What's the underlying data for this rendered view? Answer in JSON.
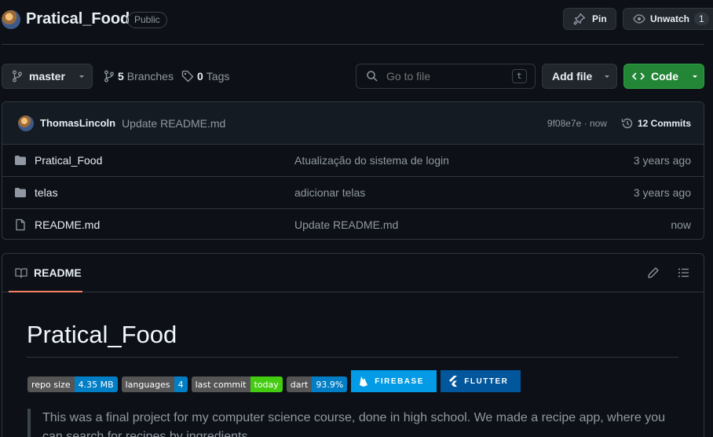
{
  "repo": {
    "name": "Pratical_Food",
    "visibility": "Public"
  },
  "header_actions": {
    "pin_label": "Pin",
    "unwatch_label": "Unwatch",
    "watch_count": "1"
  },
  "toolbar": {
    "branch": "master",
    "branches_count": "5",
    "branches_label": "Branches",
    "tags_count": "0",
    "tags_label": "Tags",
    "search_placeholder": "Go to file",
    "search_shortcut": "t",
    "add_file_label": "Add file",
    "code_label": "Code"
  },
  "commit": {
    "author": "ThomasLincoln",
    "message": "Update README.md",
    "hash_time": "9f08e7e · now",
    "commits_label": "12 Commits"
  },
  "files": [
    {
      "name": "Pratical_Food",
      "icon": "folder-icon",
      "message": "Atualização do sistema de login",
      "time": "3 years ago"
    },
    {
      "name": "telas",
      "icon": "folder-icon",
      "message": "adicionar telas",
      "time": "3 years ago"
    },
    {
      "name": "README.md",
      "icon": "file-icon",
      "message": "Update README.md",
      "time": "now"
    }
  ],
  "readme": {
    "tab_label": "README",
    "title": "Pratical_Food",
    "badges": [
      {
        "label": "repo size",
        "value": "4.35 MB",
        "color": "#007ec6"
      },
      {
        "label": "languages",
        "value": "4",
        "color": "#007ec6"
      },
      {
        "label": "last commit",
        "value": "today",
        "color": "#4c1"
      },
      {
        "label": "dart",
        "value": "93.9%",
        "color": "#007ec6"
      }
    ],
    "badge_firebase": "FIREBASE",
    "badge_flutter": "FLUTTER",
    "quote": "This was a final project for my computer science course, done in high school. We made a recipe app, where you can search for recipes by ingredients."
  },
  "colors": {
    "accent_green": "#238636",
    "underline_orange": "#f78166",
    "firebase_bg": "#039be5",
    "flutter_bg": "#02569b"
  }
}
